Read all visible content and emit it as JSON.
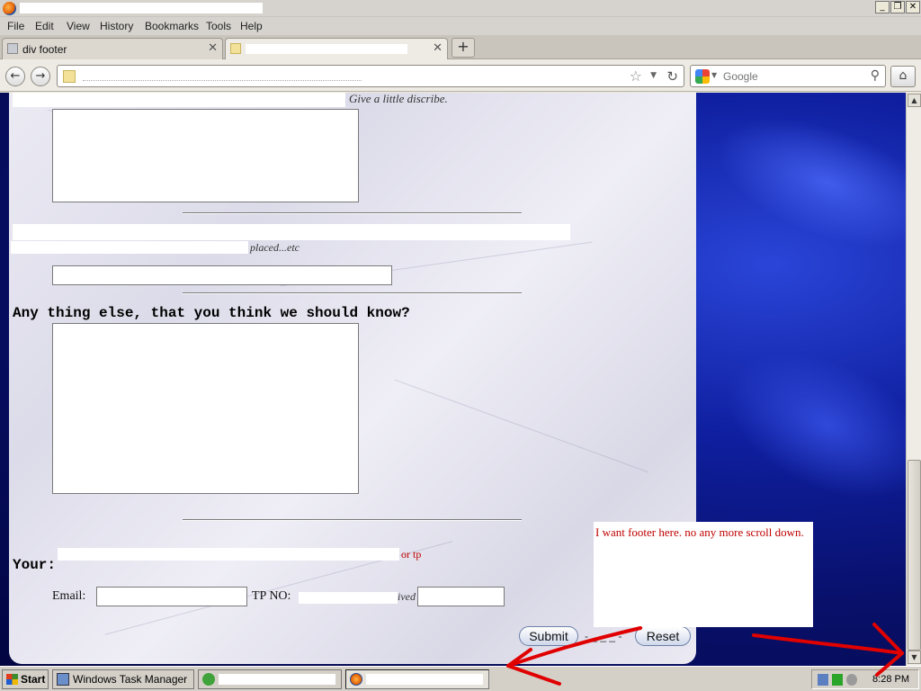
{
  "menu": {
    "items": [
      "File",
      "Edit",
      "View",
      "History",
      "Bookmarks",
      "Tools",
      "Help"
    ]
  },
  "tabs": [
    {
      "label": "div footer"
    }
  ],
  "search": {
    "placeholder": "Google"
  },
  "form": {
    "q_flash_hint": "Give a little discribe.",
    "q_design_hint": "placed...etc",
    "q_other": "Any thing else, that you think we should know?",
    "your_label": "Your:",
    "your_hint_tail": "or tp",
    "email_label": "Email:",
    "tp_label": "TP NO:",
    "tp_hint": "ived",
    "submit_label": "Submit",
    "reset_label": "Reset",
    "separator": "- _ _ _ -"
  },
  "note": {
    "text": "I want footer here. no any more scroll down."
  },
  "taskbar": {
    "start_label": "Start",
    "tasks": [
      "Windows Task Manager"
    ],
    "clock": "8:28 PM"
  },
  "colors": {
    "annotation_red": "#e00000",
    "page_bg": "#0f1fa0",
    "note_text": "#c00000"
  }
}
